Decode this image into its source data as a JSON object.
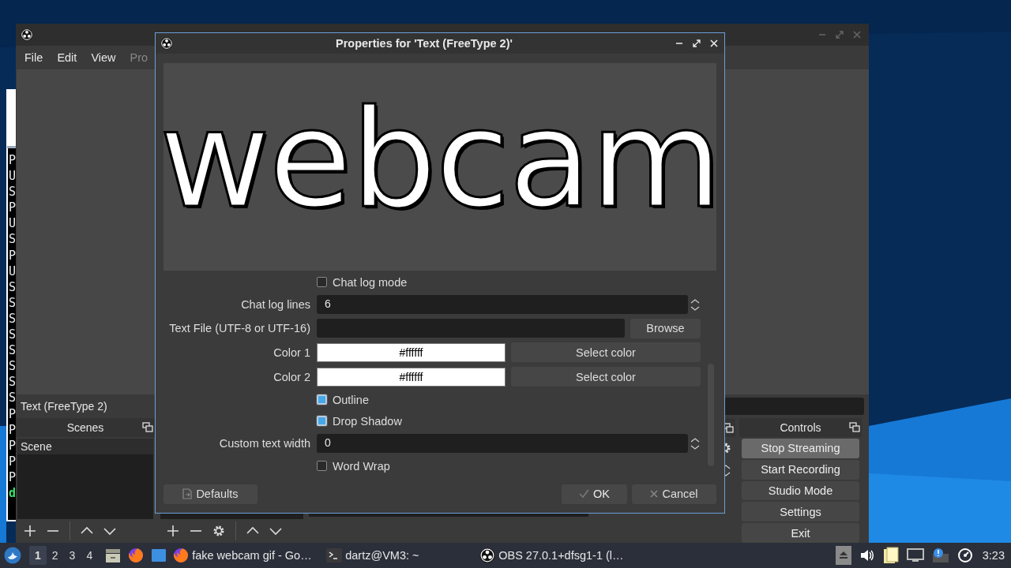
{
  "terminal": {
    "lines": [
      "P",
      "U",
      "S",
      "P",
      "U",
      "S",
      "P",
      "U",
      "S",
      "S",
      "S",
      "S",
      "S",
      "S",
      "S",
      "S",
      "P",
      "P",
      "P",
      "P",
      "P"
    ],
    "prompt": "d"
  },
  "main_window": {
    "menu": [
      "File",
      "Edit",
      "View",
      "Pro"
    ],
    "source_label": "Text (FreeType 2)",
    "scenes": {
      "title": "Scenes",
      "items": [
        {
          "label": "Scene",
          "selected": true
        }
      ]
    },
    "controls": {
      "title": "Controls",
      "buttons": [
        {
          "label": "Stop Streaming",
          "active": true
        },
        {
          "label": "Start Recording",
          "active": false
        },
        {
          "label": "Studio Mode",
          "active": false
        },
        {
          "label": "Settings",
          "active": false
        },
        {
          "label": "Exit",
          "active": false
        }
      ]
    }
  },
  "dialog": {
    "title": "Properties for 'Text (FreeType 2)'",
    "preview_text": "webcam",
    "fields": [
      {
        "kind": "checkbox",
        "label": "Chat log mode",
        "checked": false
      },
      {
        "kind": "spin",
        "label": "Chat log lines",
        "value": "6"
      },
      {
        "kind": "file",
        "label": "Text File (UTF-8 or UTF-16)",
        "button": "Browse"
      },
      {
        "kind": "color",
        "label": "Color 1",
        "value": "#ffffff",
        "button": "Select color"
      },
      {
        "kind": "color",
        "label": "Color 2",
        "value": "#ffffff",
        "button": "Select color"
      },
      {
        "kind": "checkbox",
        "label": "Outline",
        "checked": true
      },
      {
        "kind": "checkbox",
        "label": "Drop Shadow",
        "checked": true
      },
      {
        "kind": "spin",
        "label": "Custom text width",
        "value": "0"
      },
      {
        "kind": "checkbox",
        "label": "Word Wrap",
        "checked": false
      }
    ],
    "defaults": "Defaults",
    "ok": "OK",
    "cancel": "Cancel"
  },
  "taskbar": {
    "workspaces": [
      {
        "label": "1",
        "selected": true
      },
      {
        "label": "2",
        "selected": false
      },
      {
        "label": "3",
        "selected": false
      },
      {
        "label": "4",
        "selected": false
      }
    ],
    "tasks": [
      {
        "kind": "browser",
        "label": "fake webcam gif - Go…"
      },
      {
        "kind": "terminal",
        "label": "dartz@VM3: ~"
      },
      {
        "kind": "obs",
        "label": "OBS 27.0.1+dfsg1-1 (l…"
      }
    ],
    "clock": "3:23"
  }
}
